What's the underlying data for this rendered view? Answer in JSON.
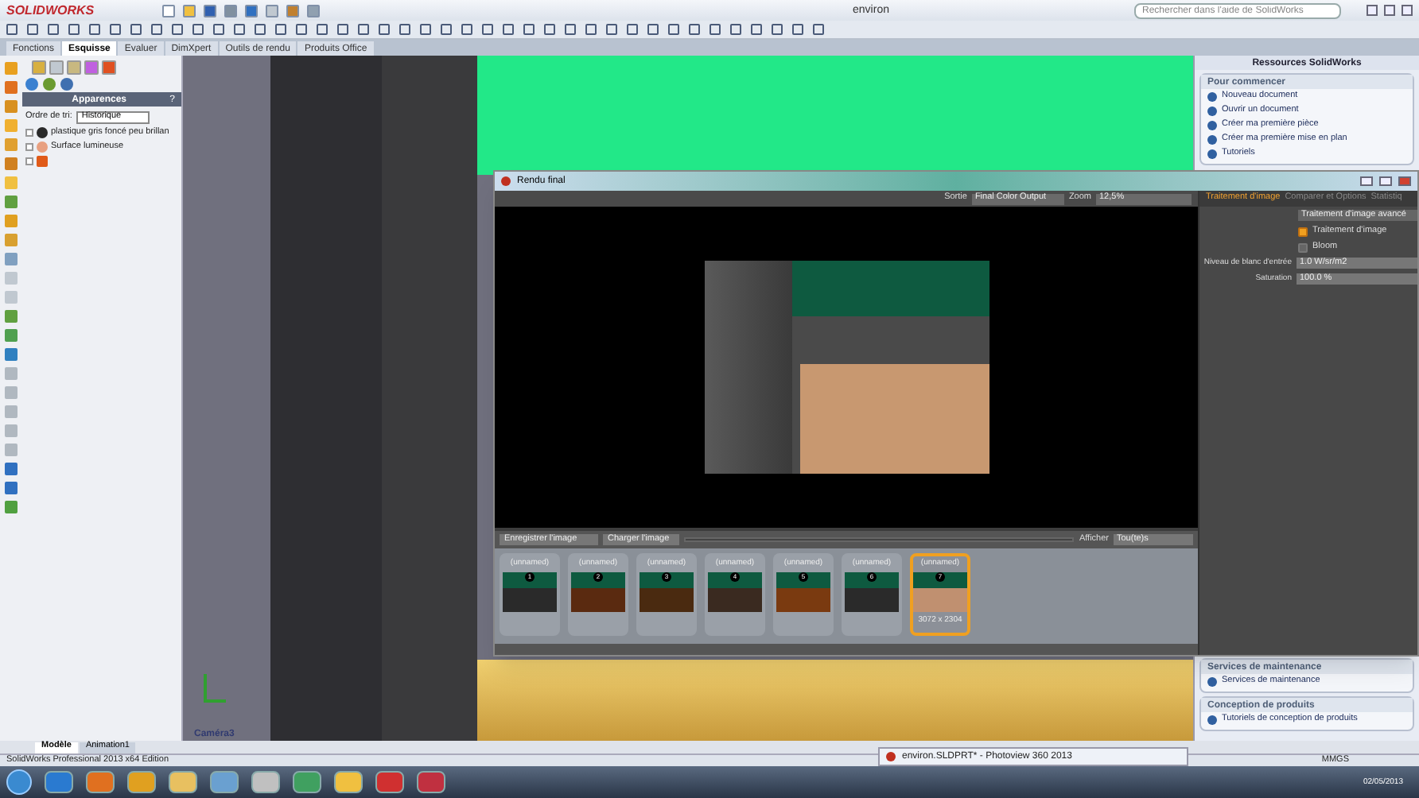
{
  "app": {
    "logo": "SOLIDWORKS",
    "title": "environ",
    "search": {
      "placeholder": "Rechercher dans l'aide de SolidWorks"
    }
  },
  "command_tabs": [
    {
      "label": "Fonctions",
      "selected": false
    },
    {
      "label": "Esquisse",
      "selected": true
    },
    {
      "label": "Evaluer",
      "selected": false
    },
    {
      "label": "DimXpert",
      "selected": false
    },
    {
      "label": "Outils de rendu",
      "selected": false
    },
    {
      "label": "Produits Office",
      "selected": false
    }
  ],
  "appearance_panel": {
    "title": "Apparences",
    "help": "?",
    "sort_label": "Ordre de tri:",
    "sort_value": "Historique",
    "tree": [
      {
        "label": "plastique gris foncé peu brillan",
        "color": "#2a2a2a"
      },
      {
        "label": "Surface lumineuse",
        "color": "#e8a080"
      },
      {
        "color": "#e05a18"
      }
    ]
  },
  "viewport": {
    "camera_label": "Caméra3"
  },
  "model_tabs": [
    {
      "label": "Modèle",
      "selected": true
    },
    {
      "label": "Animation1",
      "selected": false
    }
  ],
  "status_bar": {
    "product": "SolidWorks Professional 2013 x64 Edition",
    "units": "MMGS"
  },
  "task_pane": {
    "title": "Ressources SolidWorks",
    "sections": [
      {
        "title": "Pour commencer",
        "links": [
          "Nouveau document",
          "Ouvrir un document",
          "Créer ma première pièce",
          "Créer ma première mise en plan",
          "Tutoriels"
        ]
      },
      {
        "title": "Services de maintenance",
        "links": [
          "Services de maintenance"
        ]
      },
      {
        "title": "Conception de produits",
        "links": [
          "Tutoriels de conception de produits"
        ]
      }
    ]
  },
  "render_window": {
    "title": "Rendu final",
    "output_label": "Sortie",
    "output_value": "Final Color Output",
    "zoom_label": "Zoom",
    "zoom_value": "12,5%",
    "save_button": "Enregistrer l'image",
    "load_button": "Charger l'image",
    "show_label": "Afficher",
    "show_value": "Tou(te)s",
    "thumbnails": [
      {
        "label": "(unnamed)",
        "number": "1",
        "selected": false
      },
      {
        "label": "(unnamed)",
        "number": "2",
        "selected": false
      },
      {
        "label": "(unnamed)",
        "number": "3",
        "selected": false
      },
      {
        "label": "(unnamed)",
        "number": "4",
        "selected": false
      },
      {
        "label": "(unnamed)",
        "number": "5",
        "selected": false
      },
      {
        "label": "(unnamed)",
        "number": "6",
        "selected": false
      },
      {
        "label": "(unnamed)",
        "number": "7",
        "selected": true,
        "size": "3072 x 2304"
      }
    ],
    "side_tabs": [
      {
        "label": "Traitement d'image",
        "selected": true
      },
      {
        "label": "Comparer et Options",
        "selected": false
      },
      {
        "label": "Statistiq",
        "selected": false
      }
    ],
    "advanced_button": "Traitement d'image avancé",
    "options": [
      {
        "label": "Traitement d'image",
        "checked": true
      },
      {
        "label": "Bloom",
        "checked": false
      }
    ],
    "fields": [
      {
        "label": "Niveau de blanc d'entrée",
        "value": "1.0 W/sr/m2"
      },
      {
        "label": "Saturation",
        "value": "100.0 %"
      }
    ]
  },
  "minimized_window": {
    "title": "environ.SLDPRT* - Photoview 360 2013"
  },
  "taskbar": {
    "date": "02/05/2013"
  }
}
